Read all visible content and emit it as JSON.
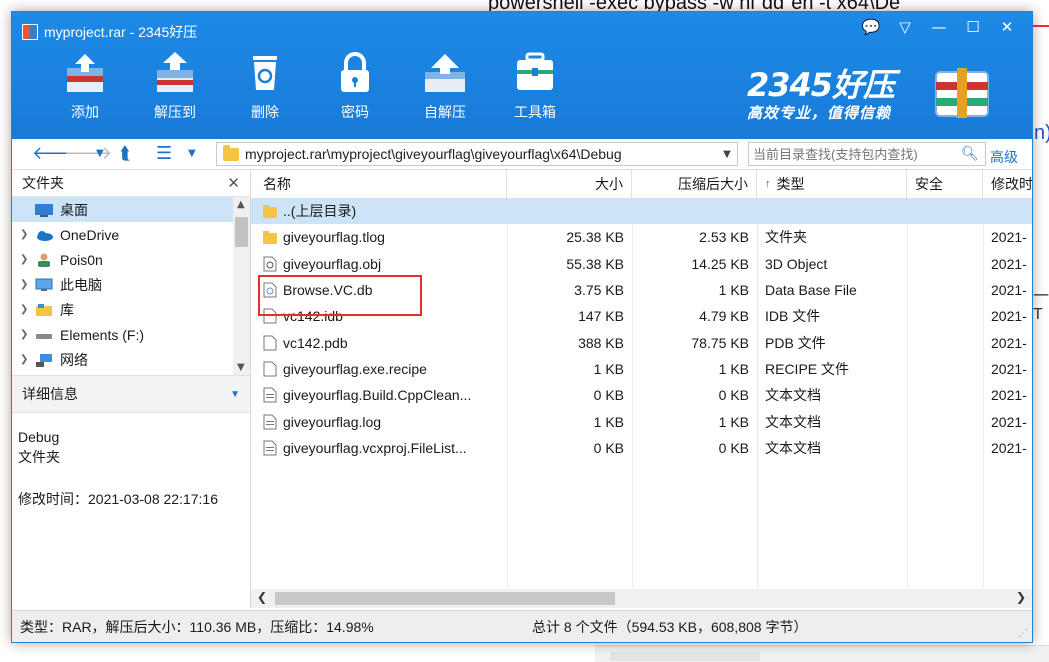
{
  "background": {
    "command_text": "powershell -exec bypass -w hi\"dd\"en -t x64\\De",
    "side_text": "n)",
    "dash_text": "一T"
  },
  "window": {
    "title": "myproject.rar - 2345好压",
    "controls": [
      "💬",
      "▽",
      "—",
      "☐",
      "✕"
    ]
  },
  "toolbar": {
    "items": [
      {
        "label": "添加",
        "icon": "add-archive-icon"
      },
      {
        "label": "解压到",
        "icon": "extract-icon"
      },
      {
        "label": "删除",
        "icon": "delete-icon"
      },
      {
        "label": "密码",
        "icon": "password-lock-icon"
      },
      {
        "label": "自解压",
        "icon": "self-extract-icon"
      },
      {
        "label": "工具箱",
        "icon": "toolbox-icon"
      }
    ]
  },
  "brand": {
    "name": "2345好压",
    "slogan": "高效专业，值得信赖"
  },
  "navbar": {
    "path": "myproject.rar\\myproject\\giveyourflag\\giveyourflag\\x64\\Debug",
    "search_placeholder": "当前目录查找(支持包内查找)",
    "advanced": "高级"
  },
  "left_panel": {
    "folders_title": "文件夹",
    "tree": [
      {
        "label": "桌面",
        "icon": "desktop-icon",
        "selected": true
      },
      {
        "label": "OneDrive",
        "icon": "cloud-icon"
      },
      {
        "label": "Pois0n",
        "icon": "user-icon"
      },
      {
        "label": "此电脑",
        "icon": "computer-icon"
      },
      {
        "label": "库",
        "icon": "library-icon"
      },
      {
        "label": "Elements (F:)",
        "icon": "drive-icon"
      },
      {
        "label": "网络",
        "icon": "network-icon"
      }
    ],
    "details_title": "详细信息",
    "details": {
      "name": "Debug",
      "kind": "文件夹",
      "modified": "修改时间：2021-03-08 22:17:16"
    }
  },
  "file_list": {
    "columns": [
      "名称",
      "大小",
      "压缩后大小",
      "类型",
      "安全",
      "修改时"
    ],
    "sort_indicator": "↑",
    "rows": [
      {
        "name": "..(上层目录)",
        "size": "",
        "compressed": "",
        "type": "",
        "modified": "",
        "icon": "folder-up-icon"
      },
      {
        "name": "giveyourflag.tlog",
        "size": "25.38 KB",
        "compressed": "2.53 KB",
        "type": "文件夹",
        "modified": "2021-",
        "icon": "folder-icon"
      },
      {
        "name": "giveyourflag.obj",
        "size": "55.38 KB",
        "compressed": "14.25 KB",
        "type": "3D Object",
        "modified": "2021-",
        "icon": "object-file-icon"
      },
      {
        "name": "Browse.VC.db",
        "size": "3.75 KB",
        "compressed": "1 KB",
        "type": "Data Base File",
        "modified": "2021-",
        "icon": "database-file-icon"
      },
      {
        "name": "vc142.idb",
        "size": "147 KB",
        "compressed": "4.79 KB",
        "type": "IDB 文件",
        "modified": "2021-",
        "icon": "file-icon"
      },
      {
        "name": "vc142.pdb",
        "size": "388 KB",
        "compressed": "78.75 KB",
        "type": "PDB 文件",
        "modified": "2021-",
        "icon": "file-icon"
      },
      {
        "name": "giveyourflag.exe.recipe",
        "size": "1 KB",
        "compressed": "1 KB",
        "type": "RECIPE 文件",
        "modified": "2021-",
        "icon": "file-icon"
      },
      {
        "name": "giveyourflag.Build.CppClean...",
        "size": "0 KB",
        "compressed": "0 KB",
        "type": "文本文档",
        "modified": "2021-",
        "icon": "text-file-icon"
      },
      {
        "name": "giveyourflag.log",
        "size": "1 KB",
        "compressed": "1 KB",
        "type": "文本文档",
        "modified": "2021-",
        "icon": "text-file-icon"
      },
      {
        "name": "giveyourflag.vcxproj.FileList...",
        "size": "0 KB",
        "compressed": "0 KB",
        "type": "文本文档",
        "modified": "2021-",
        "icon": "text-file-icon"
      }
    ]
  },
  "status": {
    "left": "类型：RAR，解压后大小：110.36 MB，压缩比：14.98%",
    "middle": "总计 8 个文件（594.53 KB，608,808 字节）"
  },
  "colors": {
    "titlebar": "#1a7fdd",
    "selection": "#cce4f7",
    "highlight_box": "#e03030"
  }
}
